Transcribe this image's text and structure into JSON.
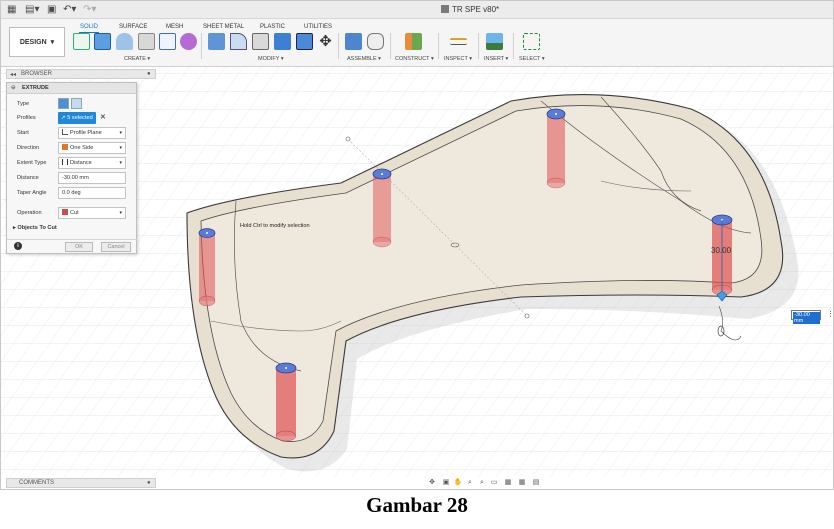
{
  "window": {
    "title": "TR SPE v80*"
  },
  "ribbon": {
    "workspace": "DESIGN",
    "tabs": [
      "SOLID",
      "SURFACE",
      "MESH",
      "SHEET METAL",
      "PLASTIC",
      "UTILITIES"
    ],
    "active_tab": "SOLID",
    "groups": [
      "CREATE",
      "MODIFY",
      "ASSEMBLE",
      "CONSTRUCT",
      "INSPECT",
      "INSERT",
      "SELECT"
    ]
  },
  "browser": {
    "label": "BROWSER"
  },
  "extrude": {
    "title": "EXTRUDE",
    "type_label": "Type",
    "profiles_label": "Profiles",
    "profiles_value": "5 selected",
    "start_label": "Start",
    "start_value": "Profile Plane",
    "direction_label": "Direction",
    "direction_value": "One Side",
    "extent_label": "Extent Type",
    "extent_value": "Distance",
    "distance_label": "Distance",
    "distance_value": "-30.00 mm",
    "taper_label": "Taper Angle",
    "taper_value": "0.0 deg",
    "operation_label": "Operation",
    "operation_value": "Cut",
    "objects_label": "Objects To Cut",
    "ok_label": "OK",
    "cancel_label": "Cancel"
  },
  "viewport": {
    "hint": "Hold Ctrl to modify selection",
    "dimension_label": "30.00",
    "distance_input": "-30.00 mm"
  },
  "comments": {
    "label": "COMMENTS"
  },
  "caption": "Gambar 28",
  "colors": {
    "accent": "#1e88d9",
    "cut_body": "#e05050",
    "model": "#e7dfcf"
  }
}
